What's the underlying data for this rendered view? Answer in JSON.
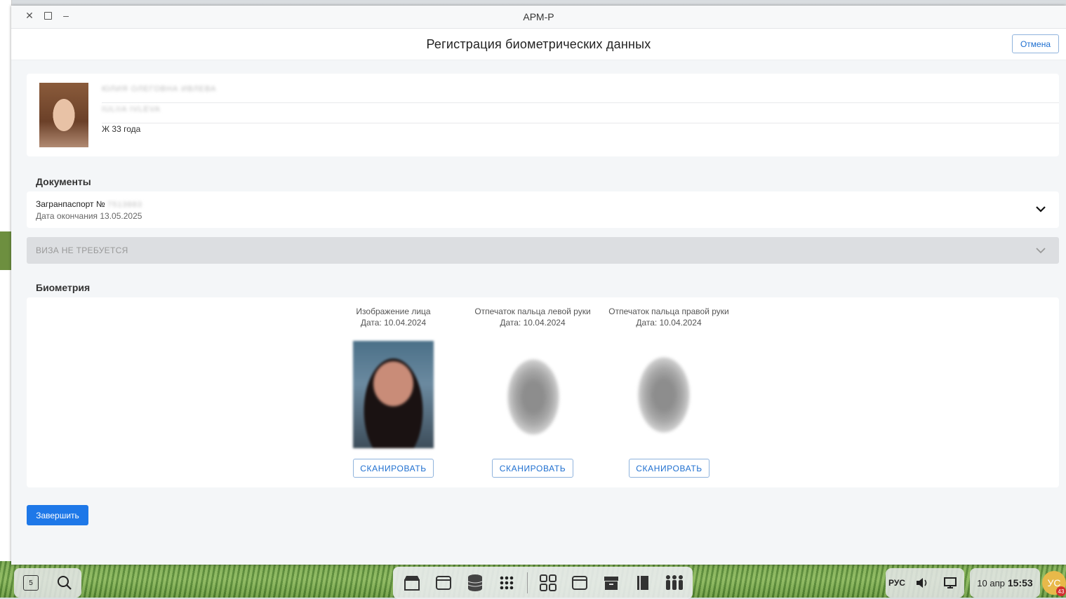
{
  "window": {
    "title": "АРМ-Р"
  },
  "header": {
    "title": "Регистрация биометрических данных",
    "cancel_label": "Отмена"
  },
  "person": {
    "gender_age": "Ж 33 года"
  },
  "documents": {
    "section_title": "Документы",
    "passport_label": "Загранпаспорт №",
    "expiry": "Дата окончания 13.05.2025",
    "visa_label": "ВИЗА НЕ ТРЕБУЕТСЯ"
  },
  "biometrics": {
    "section_title": "Биометрия",
    "items": [
      {
        "label": "Изображение лица",
        "date": "Дата: 10.04.2024",
        "button": "СКАНИРОВАТЬ"
      },
      {
        "label": "Отпечаток пальца левой руки",
        "date": "Дата: 10.04.2024",
        "button": "СКАНИРОВАТЬ"
      },
      {
        "label": "Отпечаток пальца правой руки",
        "date": "Дата: 10.04.2024",
        "button": "СКАНИРОВАТЬ"
      }
    ]
  },
  "finish_label": "Завершить",
  "taskbar": {
    "workspace": "5",
    "lang": "РУС",
    "date": "10 апр",
    "time": "15:53",
    "avatar": "УС",
    "badge": "43"
  }
}
